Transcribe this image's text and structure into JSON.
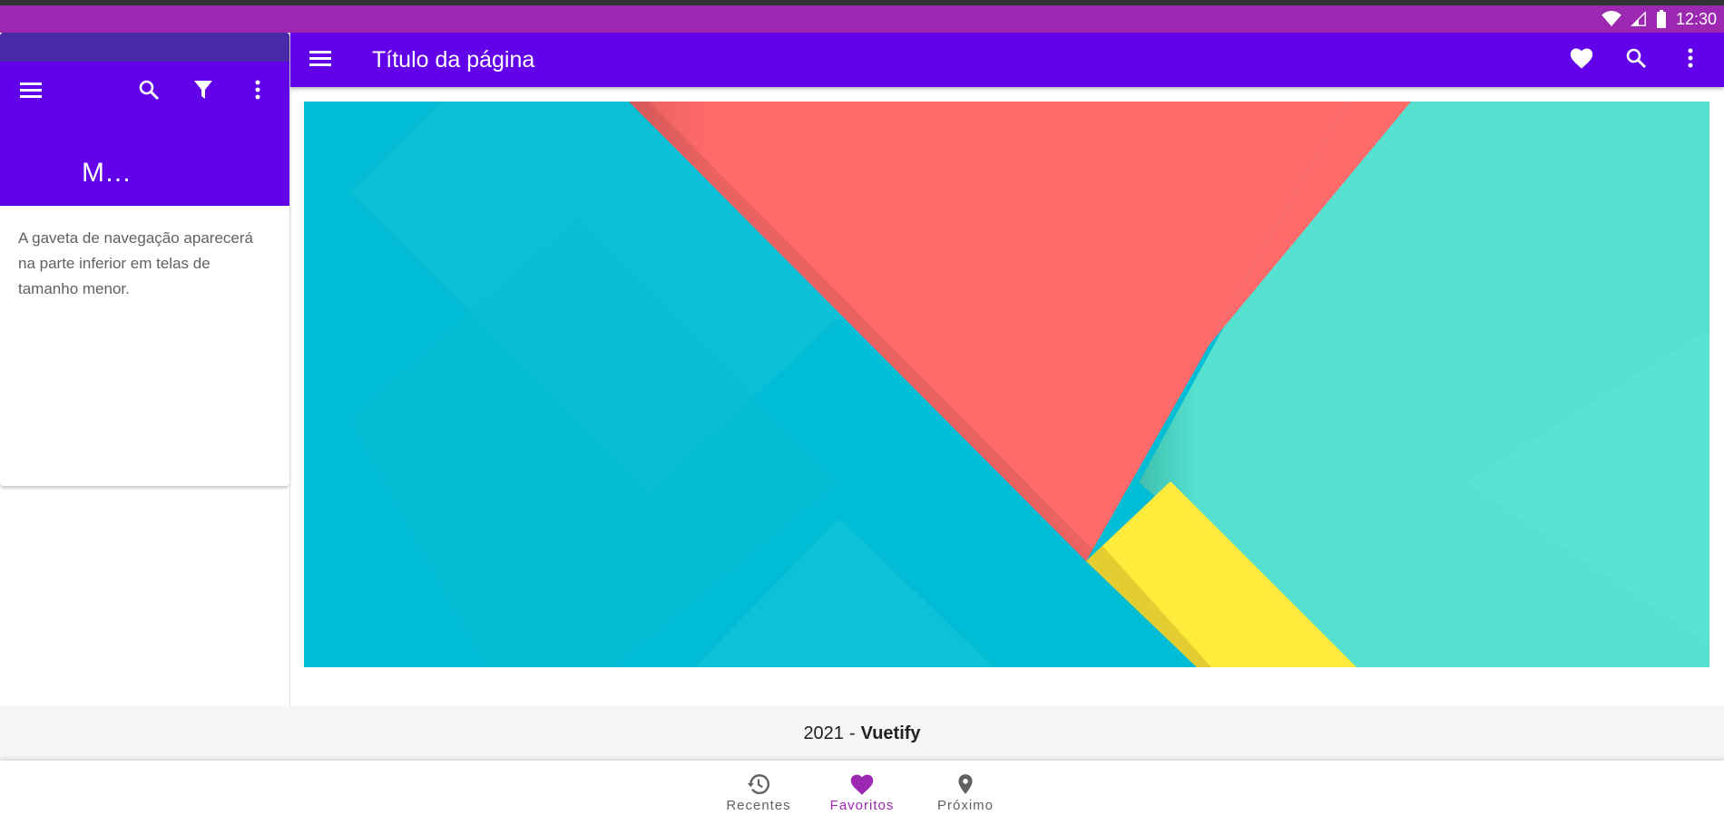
{
  "status_bar": {
    "time": "12:30",
    "icons": [
      "wifi-icon",
      "signal-icon",
      "battery-icon"
    ]
  },
  "drawer": {
    "title": "M…",
    "description": "A gaveta de navegação aparecerá na parte inferior em telas de tamanho menor.",
    "icons": [
      "menu-icon",
      "search-icon",
      "filter-icon",
      "more-vert-icon"
    ]
  },
  "app_bar": {
    "title": "Título da página",
    "icons": [
      "menu-icon",
      "heart-icon",
      "search-icon",
      "more-vert-icon"
    ]
  },
  "footer": {
    "year": "2021",
    "separator": "-",
    "brand": "Vuetify"
  },
  "bottom_nav": {
    "items": [
      {
        "label": "Recentes",
        "icon": "history-icon",
        "active": false
      },
      {
        "label": "Favoritos",
        "icon": "heart-icon",
        "active": true
      },
      {
        "label": "Próximo",
        "icon": "location-pin-icon",
        "active": false
      }
    ]
  },
  "colors": {
    "primary": "#6200ea",
    "status_bar": "#9c27b0",
    "accent": "#9c27b0",
    "hero_cyan": "#00bcd4",
    "hero_coral": "#ff6b6b",
    "hero_teal": "#55e0cf",
    "hero_yellow": "#ffeb3b"
  }
}
